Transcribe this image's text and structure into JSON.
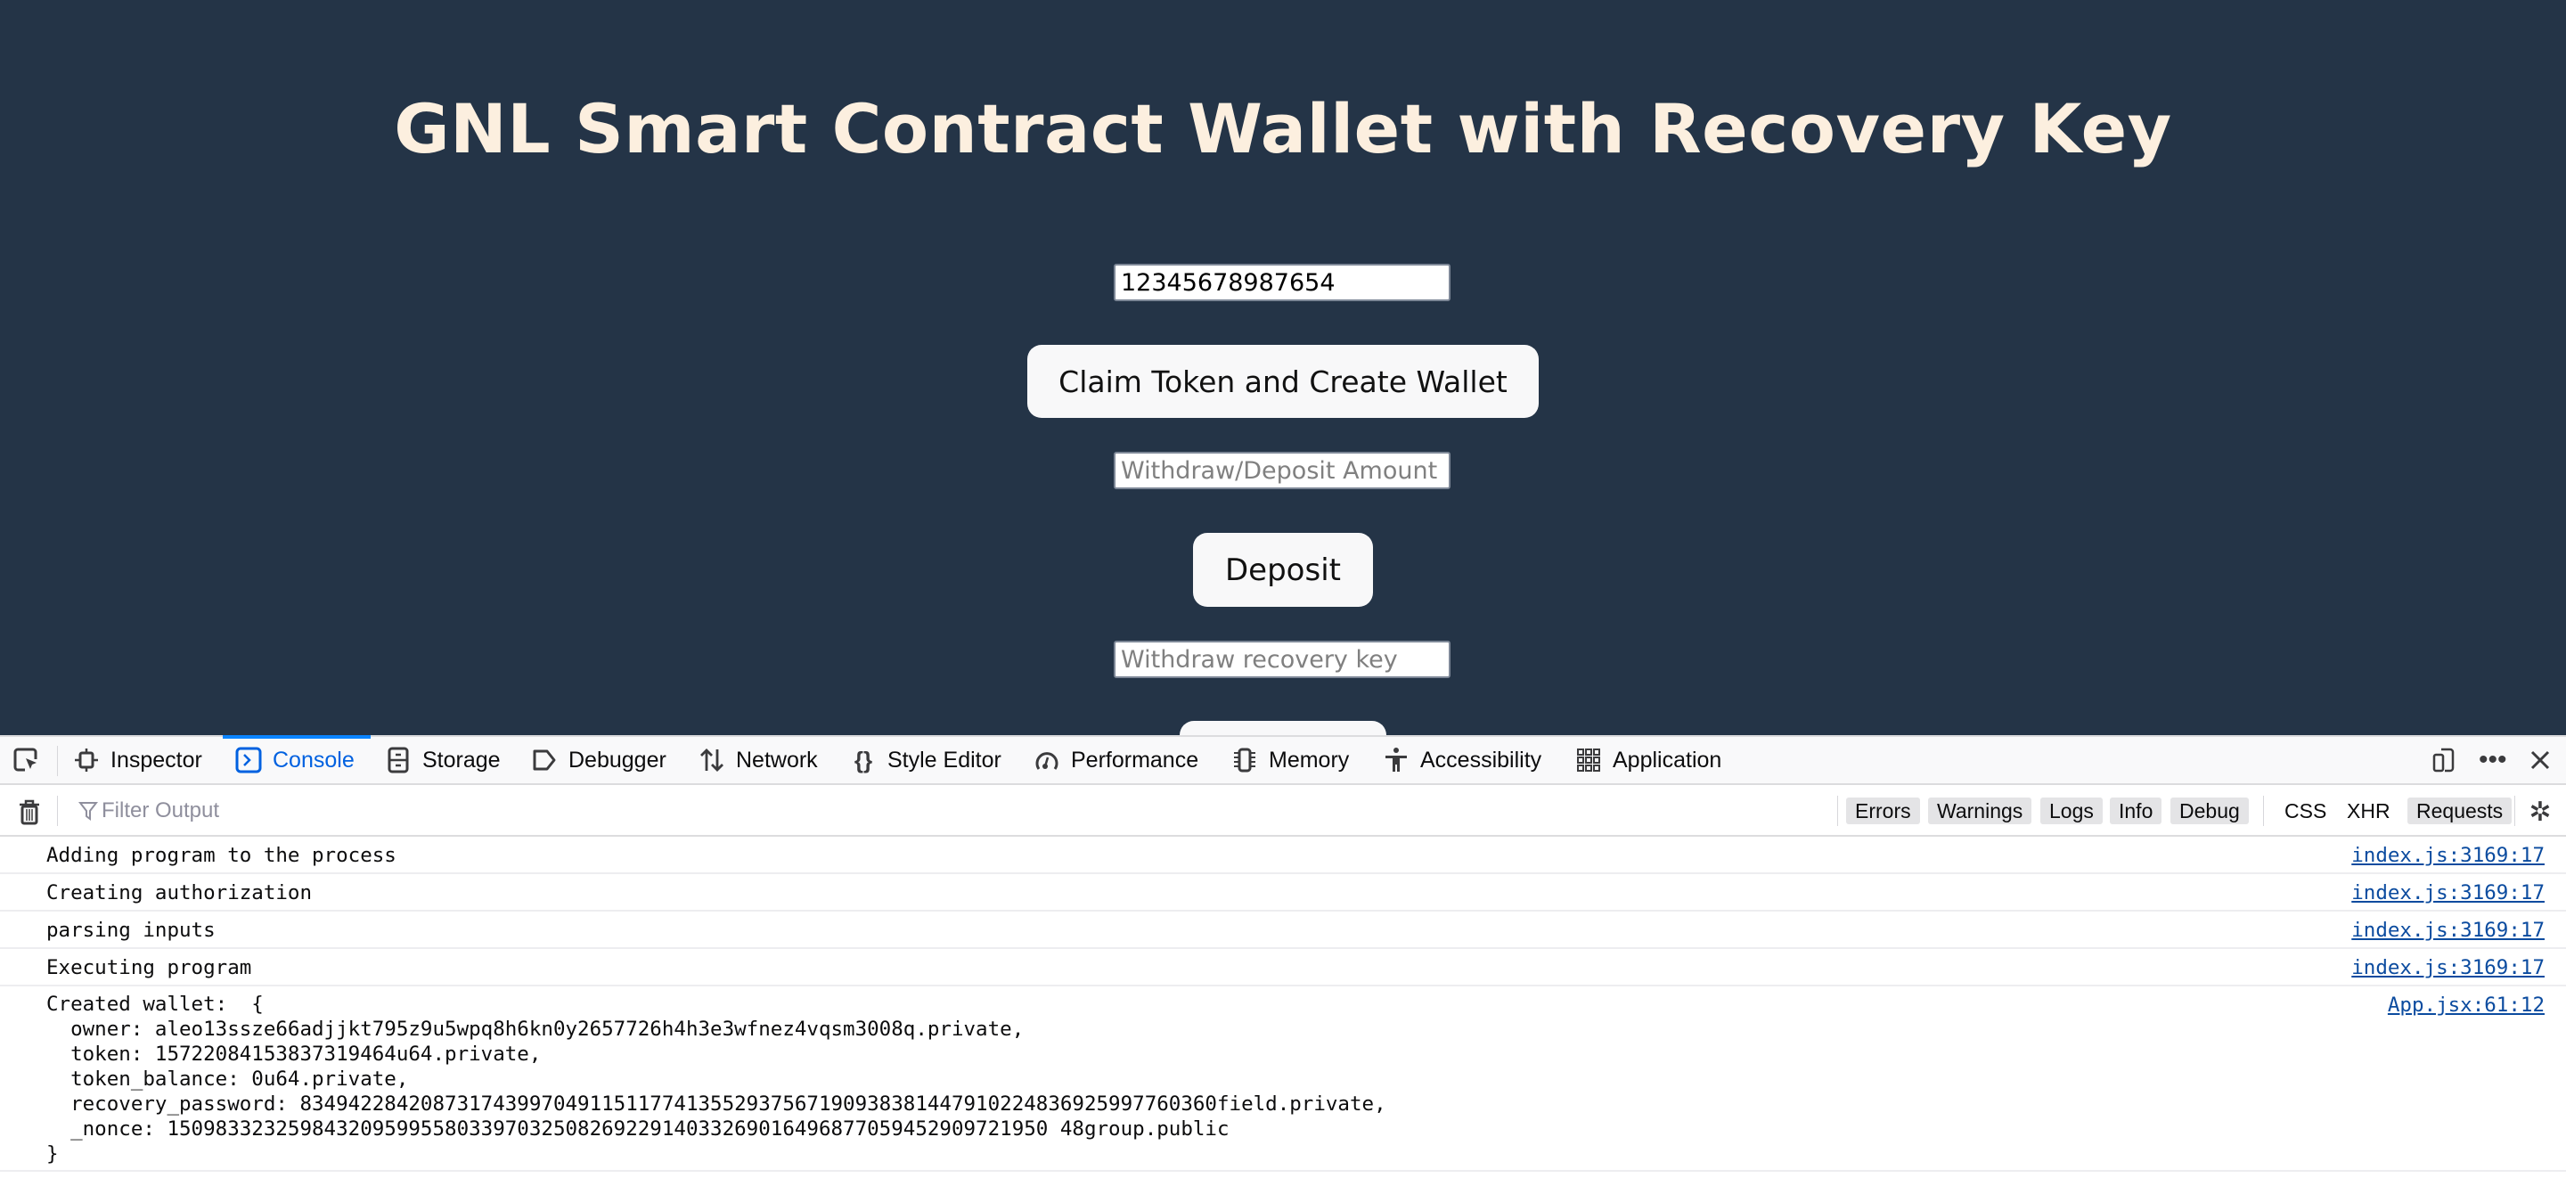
{
  "page": {
    "title": "GNL Smart Contract Wallet with Recovery Key",
    "token_input": {
      "value": "12345678987654",
      "placeholder": ""
    },
    "claim_button": "Claim Token and Create Wallet",
    "amount_input": {
      "value": "",
      "placeholder": "Withdraw/Deposit Amount"
    },
    "deposit_button": "Deposit",
    "recovery_input": {
      "value": "",
      "placeholder": "Withdraw recovery key"
    }
  },
  "devtools": {
    "tabs": [
      {
        "label": "Inspector",
        "icon": "inspector-icon"
      },
      {
        "label": "Console",
        "icon": "console-icon",
        "active": true
      },
      {
        "label": "Storage",
        "icon": "storage-icon"
      },
      {
        "label": "Debugger",
        "icon": "debugger-icon"
      },
      {
        "label": "Network",
        "icon": "network-icon"
      },
      {
        "label": "Style Editor",
        "icon": "style-editor-icon"
      },
      {
        "label": "Performance",
        "icon": "performance-icon"
      },
      {
        "label": "Memory",
        "icon": "memory-icon"
      },
      {
        "label": "Accessibility",
        "icon": "accessibility-icon"
      },
      {
        "label": "Application",
        "icon": "application-icon"
      }
    ],
    "filter": {
      "placeholder": "Filter Output"
    },
    "levels": [
      "Errors",
      "Warnings",
      "Logs",
      "Info",
      "Debug"
    ],
    "types": [
      "CSS",
      "XHR",
      "Requests"
    ],
    "console": [
      {
        "message": "Adding program to the process",
        "source": "index.js:3169:17"
      },
      {
        "message": "Creating authorization",
        "source": "index.js:3169:17"
      },
      {
        "message": "parsing inputs",
        "source": "index.js:3169:17"
      },
      {
        "message": "Executing program",
        "source": "index.js:3169:17"
      },
      {
        "message": "Created wallet:  {\n  owner: aleo13ssze66adjjkt795z9u5wpq8h6kn0y2657726h4h3e3wfnez4vqsm3008q.private,\n  token: 15722084153837319464u64.private,\n  token_balance: 0u64.private,\n  recovery_password: 8349422842087317439970491151177413552937567190938381447910224836925997760360field.private,\n  _nonce: 1509833232598432095995580339703250826922914033269016496877059452909721950 48group.public\n}",
        "source": "App.jsx:61:12"
      }
    ]
  }
}
